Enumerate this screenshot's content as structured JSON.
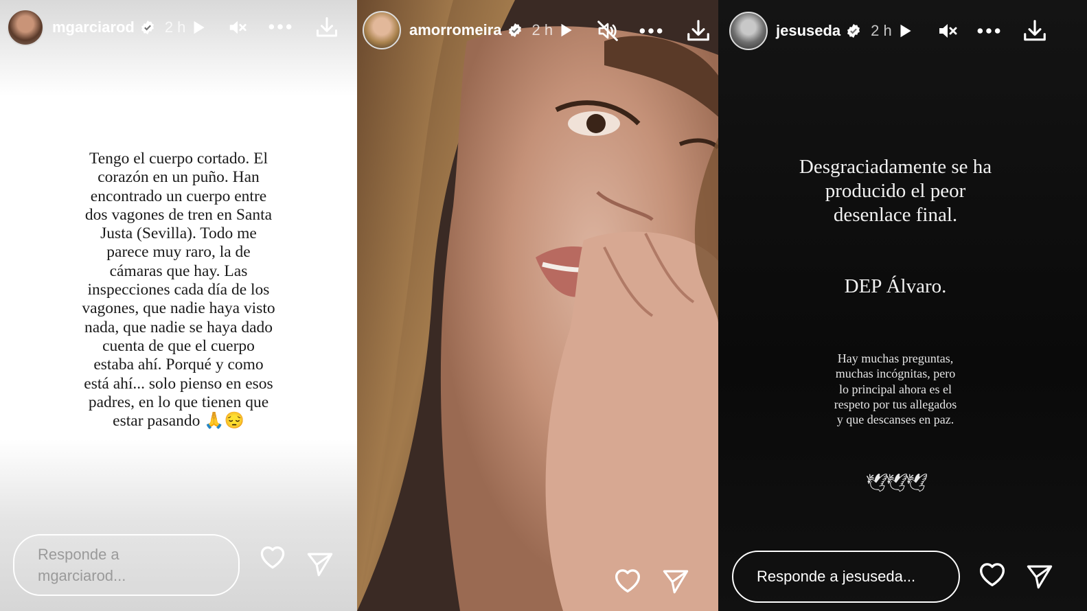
{
  "stories": [
    {
      "username": "mgarciarod",
      "time": "2 h",
      "text": "Tengo el cuerpo cortado. El\ncorazón en un puño. Han\nencontrado un cuerpo entre\ndos vagones de tren en Santa\nJusta (Sevilla). Todo me\nparece muy raro, la de\ncámaras que hay. Las\ninspecciones cada día de los\nvagones, que nadie haya visto\nnada, que nadie se haya dado\ncuenta de que el cuerpo\nestaba ahí. Porqué y como\nestá ahí... solo pienso en esos\npadres, en lo que tienen que\nestar pasando 🙏😔",
      "reply_placeholder": "Responde a\nmgarciarod..."
    },
    {
      "username": "amorromeira",
      "time": "2 h"
    },
    {
      "username": "jesuseda",
      "time": "2 h",
      "heading": "Desgraciadamente se ha\nproducido el peor\ndesenlace final.",
      "dep": "DEP Álvaro.",
      "body": "Hay muchas preguntas,\nmuchas incógnitas, pero\nlo principal ahora es el\nrespeto por tus allegados\ny que descanses en paz.",
      "emoji": "🕊🕊🕊",
      "reply_placeholder": "Responde a jesuseda..."
    }
  ],
  "icons": {
    "verified": "verified-badge-icon",
    "play": "play-icon",
    "mute": "mute-icon",
    "more": "more-icon",
    "download": "download-icon",
    "like": "heart-icon",
    "share": "send-icon"
  },
  "colors": {
    "text_dark": "#1a1a1a",
    "white": "#ffffff",
    "placeholder_light": "#9a9a9a"
  }
}
